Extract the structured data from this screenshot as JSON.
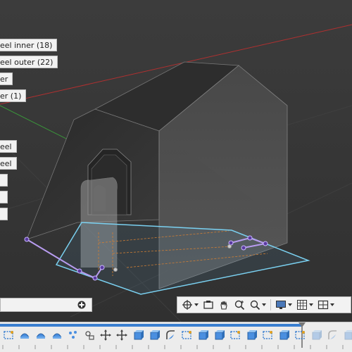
{
  "selection_labels": [
    "eel inner (18)",
    "eel outer (22)",
    "er",
    "er (1)",
    "eel",
    "eel",
    "",
    "",
    ""
  ],
  "nav_bar": {
    "items": [
      "orbit-icon",
      "look-at-icon",
      "pan-icon",
      "zoom-icon",
      "fit-icon",
      "display-settings-icon",
      "grid-icon",
      "viewports-icon"
    ]
  },
  "timeline": {
    "icons": [
      "sketch-icon",
      "arc-icon",
      "arc-icon",
      "arc-icon",
      "points-icon",
      "constraint-icon",
      "move-icon",
      "move-icon",
      "extrude-icon",
      "extrude-icon",
      "fillet-icon",
      "sketch-icon",
      "extrude-icon",
      "extrude-icon",
      "sketch-icon",
      "extrude-icon",
      "sketch-icon",
      "extrude-icon",
      "sketch-icon"
    ]
  },
  "colors": {
    "background": "#3a3a3a",
    "sketch_profile": "#7ad0f0",
    "sketch_lines": "#b89cf0",
    "hidden_edges": "#e07a20",
    "timeline_accent": "#3a7fd0"
  }
}
